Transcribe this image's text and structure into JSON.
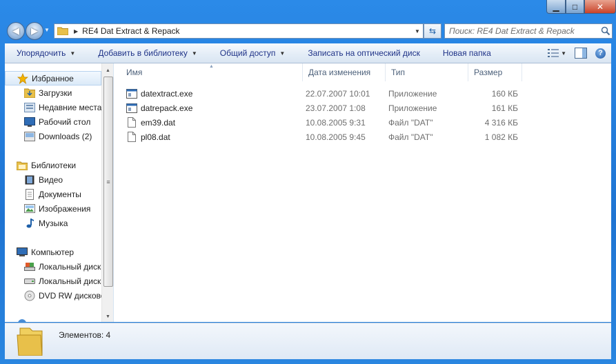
{
  "window": {
    "min_glyph": "▁",
    "max_glyph": "□",
    "close_glyph": "✕"
  },
  "nav": {
    "back_glyph": "◀",
    "forward_glyph": "▶"
  },
  "address": {
    "path": "RE4 Dat Extract & Repack"
  },
  "search": {
    "placeholder": "Поиск: RE4 Dat Extract & Repack"
  },
  "toolbar": {
    "organize": "Упорядочить",
    "add_library": "Добавить в библиотеку",
    "share": "Общий доступ",
    "burn": "Записать на оптический диск",
    "new_folder": "Новая папка",
    "help_glyph": "?"
  },
  "sidebar": {
    "favorites": "Избранное",
    "fav_items": [
      "Загрузки",
      "Недавние места",
      "Рабочий стол",
      "Downloads (2)"
    ],
    "libraries": "Библиотеки",
    "lib_items": [
      "Видео",
      "Документы",
      "Изображения",
      "Музыка"
    ],
    "computer": "Компьютер",
    "comp_items": [
      "Локальный диск",
      "Локальный диск",
      "DVD RW дисково"
    ]
  },
  "columns": {
    "name": "Имя",
    "date": "Дата изменения",
    "type": "Тип",
    "size": "Размер"
  },
  "files": [
    {
      "name": "datextract.exe",
      "date": "22.07.2007 10:01",
      "type": "Приложение",
      "size": "160 КБ",
      "icon": "exe-icon"
    },
    {
      "name": "datrepack.exe",
      "date": "23.07.2007 1:08",
      "type": "Приложение",
      "size": "161 КБ",
      "icon": "exe-icon"
    },
    {
      "name": "em39.dat",
      "date": "10.08.2005 9:31",
      "type": "Файл \"DAT\"",
      "size": "4 316 КБ",
      "icon": "file-icon"
    },
    {
      "name": "pl08.dat",
      "date": "10.08.2005 9:45",
      "type": "Файл \"DAT\"",
      "size": "1 082 КБ",
      "icon": "file-icon"
    }
  ],
  "status": {
    "count": "Элементов: 4"
  },
  "colors": {
    "frame": "#2b8ae8",
    "toolbar_text": "#1e3287",
    "folder": "#e8c04a"
  }
}
